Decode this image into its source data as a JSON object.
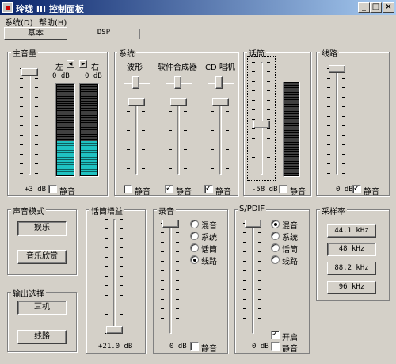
{
  "window": {
    "title": "玲珑 III 控制面板",
    "minimize": "_",
    "maximize": "□",
    "close": "×"
  },
  "menu": {
    "items": [
      {
        "label": "系统(D)"
      },
      {
        "label": "帮助(H)"
      }
    ]
  },
  "tabs": [
    {
      "label": "基本"
    },
    {
      "label": "DSP"
    }
  ],
  "master": {
    "title": "主音量",
    "left_label": "左",
    "right_label": "右",
    "left_db": "0 dB",
    "right_db": "0 dB",
    "level": "+3 dB",
    "mute_label": "静音",
    "mute_checked": false,
    "slider_fraction": 0.03,
    "meter_left_fraction": 0.38,
    "meter_right_fraction": 0.38
  },
  "system": {
    "title": "系统",
    "channels": [
      {
        "label": "波形",
        "mute_label": "静音",
        "mute_checked": false,
        "slider_fraction": 0.0
      },
      {
        "label": "软件合成器",
        "mute_label": "静音",
        "mute_checked": true,
        "slider_fraction": 0.0
      },
      {
        "label": "CD 唱机",
        "mute_label": "静音",
        "mute_checked": true,
        "slider_fraction": 0.0
      }
    ]
  },
  "mic": {
    "title": "话筒",
    "level": "-58 dB",
    "mute_label": "静音",
    "mute_checked": false,
    "slider_fraction": 0.55,
    "meter_fraction": 0.0
  },
  "line": {
    "title": "线路",
    "level": "0 dB",
    "mute_label": "静音",
    "mute_checked": true,
    "slider_fraction": 0.0
  },
  "sound_mode": {
    "title": "声音模式",
    "buttons": [
      {
        "label": "娱乐",
        "pressed": true
      },
      {
        "label": "音乐欣赏",
        "pressed": false
      }
    ]
  },
  "output": {
    "title": "输出选择",
    "buttons": [
      {
        "label": "耳机",
        "pressed": true
      },
      {
        "label": "线路",
        "pressed": false
      }
    ]
  },
  "mic_gain": {
    "title": "话筒增益",
    "level": "+21.0 dB",
    "slider_fraction": 0.97
  },
  "record": {
    "title": "录音",
    "options": [
      {
        "label": "混音",
        "checked": false
      },
      {
        "label": "系统",
        "checked": false
      },
      {
        "label": "话筒",
        "checked": false
      },
      {
        "label": "线路",
        "checked": true
      }
    ],
    "level": "0 dB",
    "mute_label": "静音",
    "mute_checked": false,
    "slider_fraction": 0.0
  },
  "spdif": {
    "title": "S/PDIF",
    "options": [
      {
        "label": "混音",
        "checked": true
      },
      {
        "label": "系统",
        "checked": false
      },
      {
        "label": "话筒",
        "checked": false
      },
      {
        "label": "线路",
        "checked": false
      }
    ],
    "enable_label": "开启",
    "enable_checked": true,
    "level": "0 dB",
    "mute_label": "静音",
    "mute_checked": false,
    "slider_fraction": 0.0
  },
  "sample_rate": {
    "title": "采样率",
    "buttons": [
      {
        "label": "44.1 kHz",
        "pressed": false
      },
      {
        "label": "48 kHz",
        "pressed": true
      },
      {
        "label": "88.2 kHz",
        "pressed": false
      },
      {
        "label": "96 kHz",
        "pressed": false
      }
    ]
  },
  "colors": {
    "titlebar_start": "#0a246a",
    "titlebar_end": "#a6caf0",
    "meter_lit": "#1fc2c2",
    "face": "#d4d0c8"
  }
}
